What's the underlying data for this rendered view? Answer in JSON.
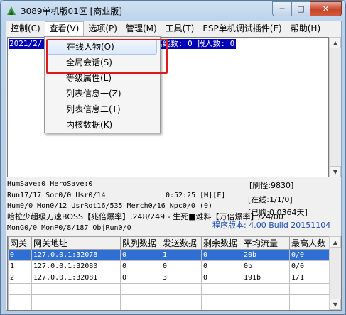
{
  "window": {
    "title": "3089单机版01区 [商业版]",
    "min_glyph": "─",
    "max_glyph": "□",
    "close_glyph": "✕"
  },
  "menu": {
    "items": [
      {
        "label": "控制(C)"
      },
      {
        "label": "查看(V)"
      },
      {
        "label": "选项(P)"
      },
      {
        "label": "管理(M)"
      },
      {
        "label": "工具(T)"
      },
      {
        "label": "ESP单机调试插件(E)"
      },
      {
        "label": "帮助(H)"
      }
    ]
  },
  "dropdown": {
    "items": [
      {
        "label": "在线人物(O)"
      },
      {
        "label": "全局会话(S)"
      },
      {
        "label": "等级属性(L)"
      },
      {
        "label": "列表信息一(Z)"
      },
      {
        "label": "列表信息二(T)"
      },
      {
        "label": "内核数据(K)"
      }
    ]
  },
  "log": {
    "line1_left": "2021/2/",
    "line1_right": ": 1 离线数: 0 假人数: 0"
  },
  "status": {
    "line1": "HumSave:0 HeroSave:0",
    "line2": "Run17/17 Soc0/0 Usr0/14",
    "time": "0:52:25 [M][F]",
    "line3": "Hum0/0 Mon0/12 UsrRot16/535 Merch0/16 Npc0/0 (0)",
    "line4": "哈拉少超级刀速BOSS【兆倍爆率】,248/249 - 生死■难料【万倍爆率】/24/00",
    "line5": "MonG0/0 MonP0/8/187 ObjRun0/0",
    "refresh": "[刷怪:9830]",
    "online": "[在线:1/1/0]",
    "days": "[已购:0.0364天]",
    "version": "程序版本: 4.00 Build 20151104"
  },
  "grid": {
    "columns": [
      "网关",
      "网关地址",
      "队列数据",
      "发送数据",
      "剩余数据",
      "平均流量",
      "最高人数"
    ],
    "rows": [
      [
        "0",
        "127.0.0.1:32078",
        "0",
        "1",
        "0",
        "20b",
        "0/0"
      ],
      [
        "1",
        "127.0.0.1:32080",
        "0",
        "0",
        "0",
        "0b",
        "0/0"
      ],
      [
        "2",
        "127.0.0.1:32081",
        "0",
        "3",
        "0",
        "191b",
        "1/1"
      ]
    ]
  },
  "colors": {
    "selection": "#2f6fd4",
    "highlight_box": "#e0191b",
    "log_bg": "#0000b8"
  }
}
